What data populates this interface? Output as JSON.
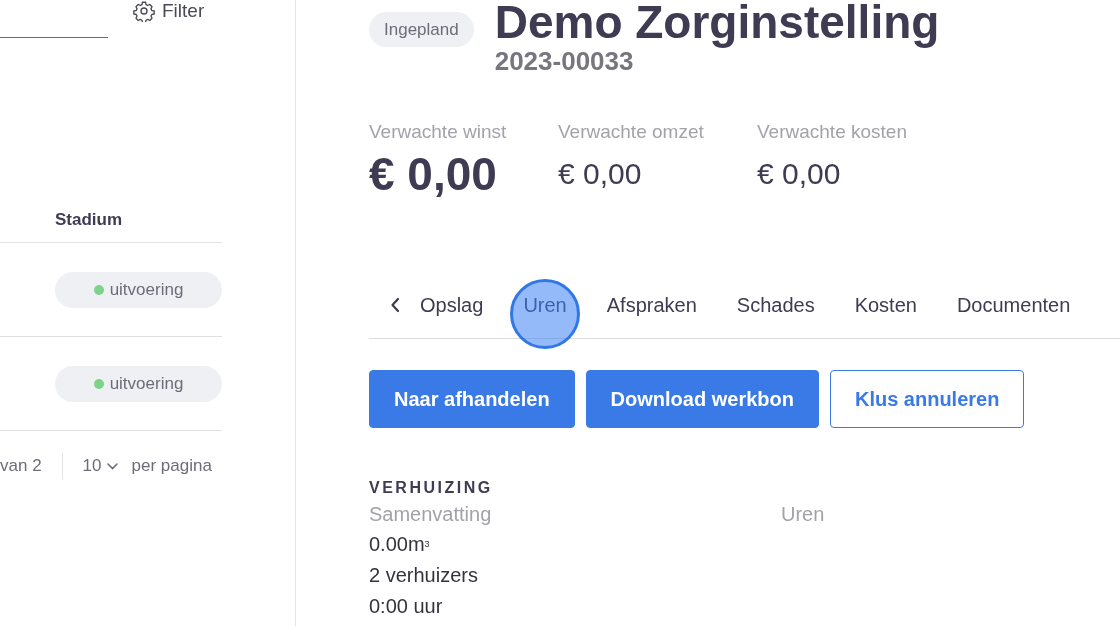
{
  "list_panel": {
    "filter_button": "Filter",
    "table": {
      "columns": [
        "Stadium"
      ],
      "rows": [
        {
          "stadium": {
            "label": "uitvoering",
            "color": "#7dd38a"
          }
        },
        {
          "stadium": {
            "label": "uitvoering",
            "color": "#7dd38a"
          }
        }
      ]
    },
    "pagination": {
      "page_info": "van 2",
      "page_size": "10",
      "per_page_label": "per pagina"
    }
  },
  "job": {
    "status": "Ingepland",
    "title": "Demo Zorginstelling",
    "number": "2023-00033",
    "metrics": [
      {
        "label": "Verwachte winst",
        "value": "€ 0,00",
        "kind": "primary"
      },
      {
        "label": "Verwachte omzet",
        "value": "€ 0,00",
        "kind": "secondary"
      },
      {
        "label": "Verwachte kosten",
        "value": "€ 0,00",
        "kind": "secondary"
      }
    ],
    "tabs": [
      {
        "label": "Opslag",
        "selected": false,
        "clicked": false
      },
      {
        "label": "Uren",
        "selected": false,
        "clicked": true
      },
      {
        "label": "Afspraken",
        "selected": false,
        "clicked": false
      },
      {
        "label": "Schades",
        "selected": false,
        "clicked": false
      },
      {
        "label": "Kosten",
        "selected": false,
        "clicked": false
      },
      {
        "label": "Documenten",
        "selected": false,
        "clicked": false
      }
    ],
    "actions": [
      {
        "label": "Naar afhandelen",
        "kind": "primary"
      },
      {
        "label": "Download werkbon",
        "kind": "primary"
      },
      {
        "label": "Klus annuleren",
        "kind": "outline"
      }
    ],
    "section": {
      "title": "VERHUIZING",
      "columns": [
        "Samenvatting",
        "Uren"
      ],
      "lines": [
        "0.00m$^{3}$",
        "2 verhuizers",
        "0:00 uur"
      ]
    }
  }
}
